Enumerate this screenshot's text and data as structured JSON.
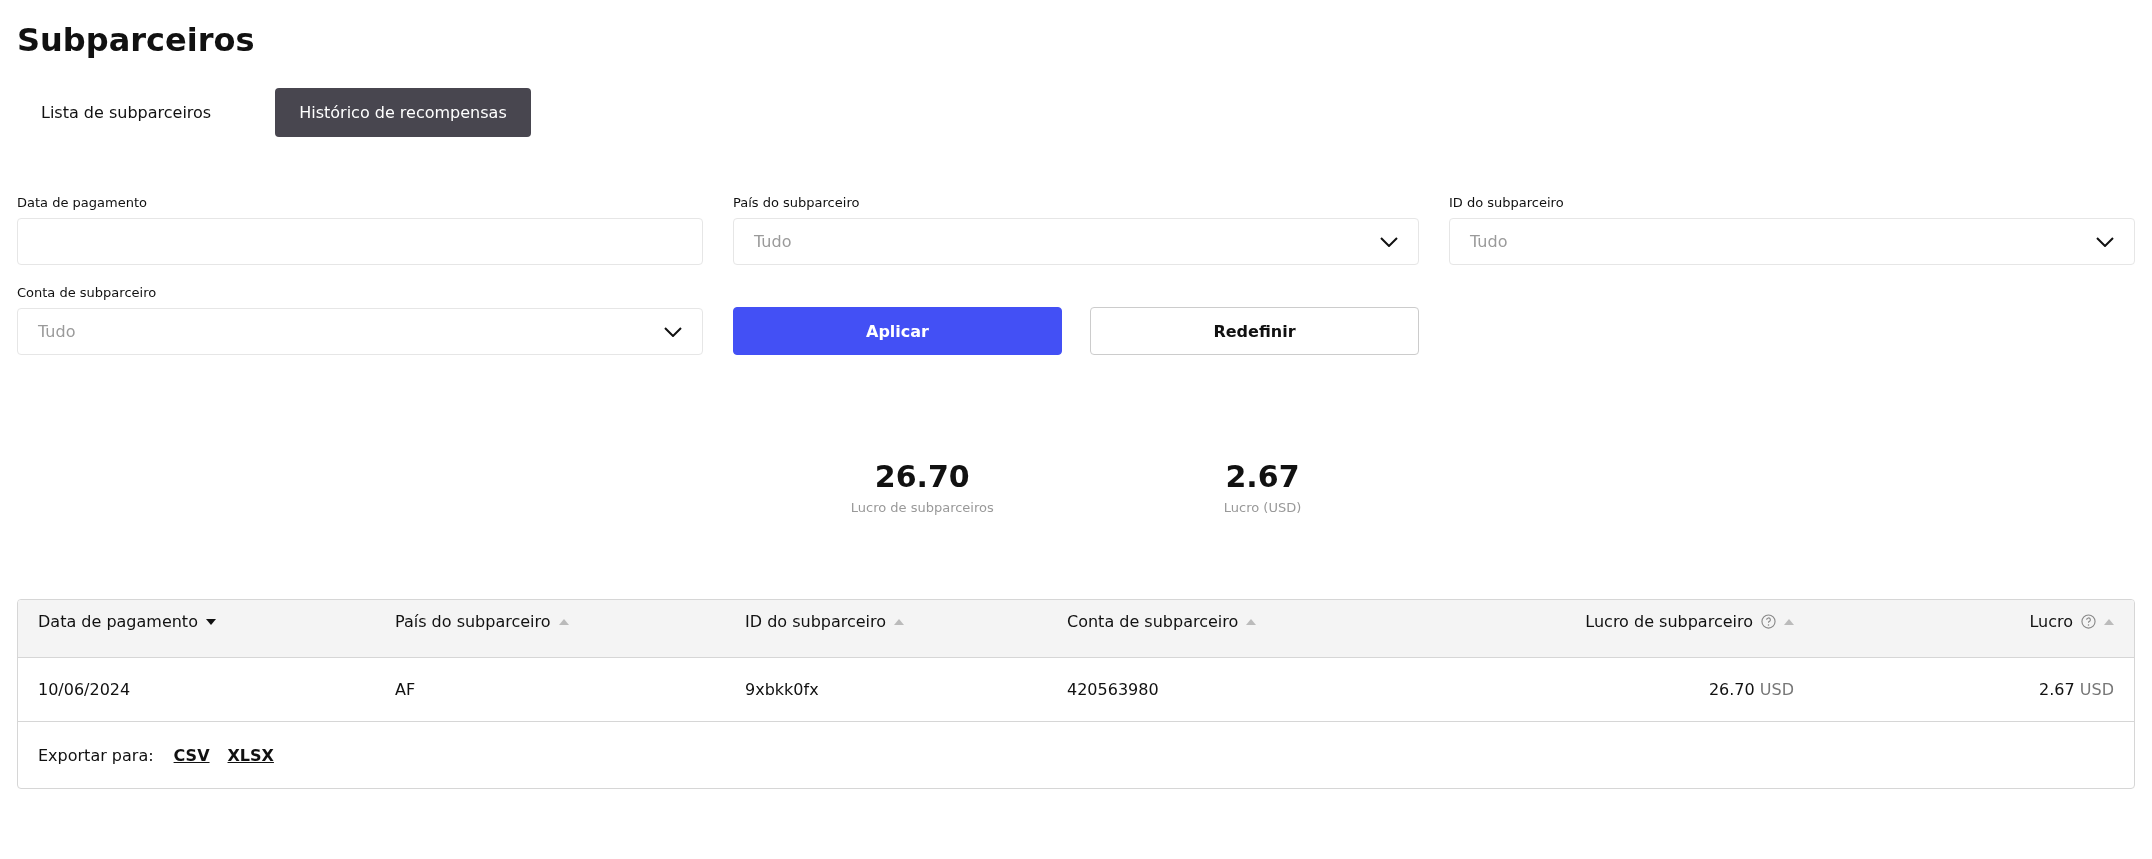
{
  "title": "Subparceiros",
  "tabs": [
    {
      "label": "Lista de subparceiros",
      "selected": false
    },
    {
      "label": "Histórico de recompensas",
      "selected": true
    }
  ],
  "filters": [
    {
      "label": "Data de pagamento",
      "kind": "date"
    },
    {
      "label": "País do subparceiro",
      "kind": "select",
      "placeholder": "Tudo"
    },
    {
      "label": "ID do subparceiro",
      "kind": "select",
      "placeholder": "Tudo"
    },
    {
      "label": "Conta de subparceiro",
      "kind": "select",
      "placeholder": "Tudo"
    }
  ],
  "buttons": [
    {
      "label": "Aplicar",
      "kind": "primary"
    },
    {
      "label": "Redefinir",
      "kind": "secondary"
    }
  ],
  "stats": [
    {
      "value": "26.70",
      "label": "Lucro de subparceiros"
    },
    {
      "value": "2.67",
      "label": "Lucro (USD)"
    }
  ],
  "table": {
    "columns": [
      {
        "label": "Data de pagamento",
        "kind": "text",
        "selected": true,
        "help": false
      },
      {
        "label": "País do subparceiro",
        "kind": "text",
        "selected": false,
        "help": false
      },
      {
        "label": "ID do subparceiro",
        "kind": "text",
        "selected": false,
        "help": false
      },
      {
        "label": "Conta de subparceiro",
        "kind": "text",
        "selected": false,
        "help": false
      },
      {
        "label": "Lucro de subparceiro",
        "kind": "amount",
        "selected": false,
        "help": true
      },
      {
        "label": "Lucro",
        "kind": "amount",
        "selected": false,
        "help": true
      }
    ],
    "rows": [
      [
        {
          "value": "10/06/2024"
        },
        {
          "value": "AF"
        },
        {
          "value": "9xbkk0fx"
        },
        {
          "value": "420563980"
        },
        {
          "value": "26.70",
          "unit": "USD"
        },
        {
          "value": "2.67",
          "unit": "USD"
        }
      ]
    ],
    "export": {
      "label": "Exportar para:",
      "links": [
        "CSV",
        "XLSX"
      ]
    }
  }
}
